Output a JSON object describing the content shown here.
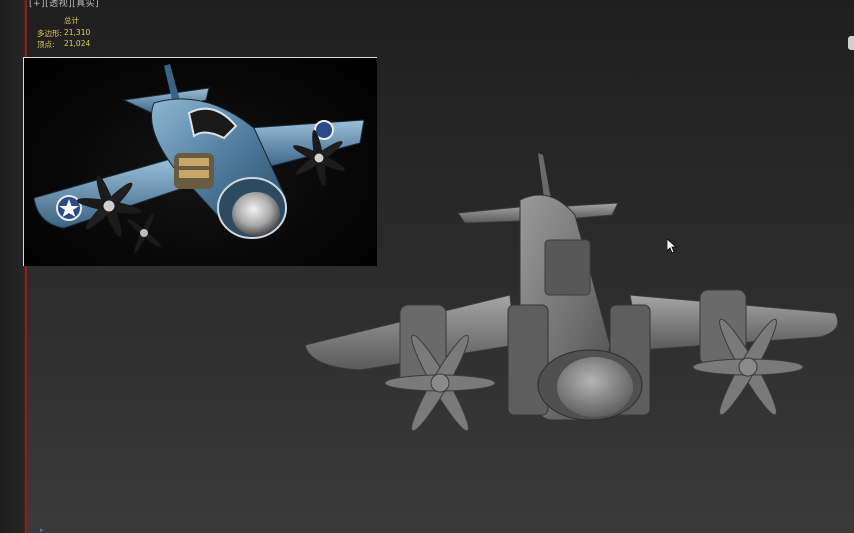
{
  "viewport": {
    "label": "[+][透视][真实]"
  },
  "stats": {
    "title": "总计",
    "polys_label": "多边形:",
    "polys_value": "21,310",
    "verts_label": "顶点:",
    "verts_value": "21,024"
  },
  "colors": {
    "stats_text": "#e3d050",
    "viewport_label": "#b8b8b8",
    "model_gray": "#7a7a7a",
    "reference_blue": "#5f8fb5",
    "left_border_accent": "#a02424"
  },
  "icons": {
    "cursor": "arrow-cursor-icon",
    "corner": "viewcube-edge-icon"
  }
}
